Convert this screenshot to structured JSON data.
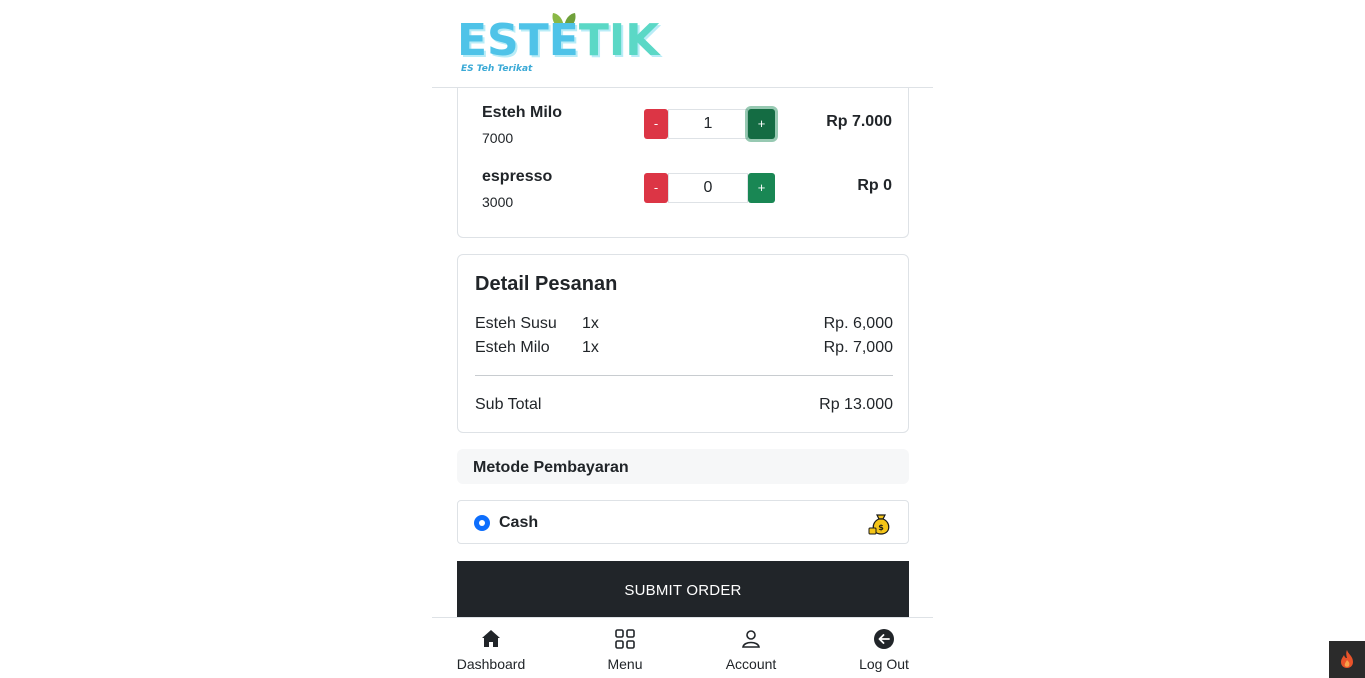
{
  "header": {
    "logo_text_a": "ESTE",
    "logo_text_b": "TIK",
    "logo_tagline": "ES Teh Terikat"
  },
  "products": [
    {
      "name": "Esteh Milo",
      "price": "7000",
      "minus": "-",
      "qty": "1",
      "plus": "+",
      "total": "Rp 7.000"
    },
    {
      "name": "espresso",
      "price": "3000",
      "minus": "-",
      "qty": "0",
      "plus": "+",
      "total": "Rp 0"
    }
  ],
  "detail": {
    "title": "Detail Pesanan",
    "items": [
      {
        "name": "Esteh Susu",
        "qty": "1x",
        "price": "Rp. 6,000"
      },
      {
        "name": "Esteh Milo",
        "qty": "1x",
        "price": "Rp. 7,000"
      }
    ],
    "subtotal_label": "Sub Total",
    "subtotal_value": "Rp 13.000"
  },
  "payment": {
    "header": "Metode Pembayaran",
    "option_label": "Cash",
    "selected": true
  },
  "submit_label": "SUBMIT ORDER",
  "nav": {
    "items": [
      {
        "label": "Dashboard",
        "icon": "house-icon"
      },
      {
        "label": "Menu",
        "icon": "grid-icon"
      },
      {
        "label": "Account",
        "icon": "person-icon"
      },
      {
        "label": "Log Out",
        "icon": "arrow-left-circle-icon"
      }
    ]
  },
  "colors": {
    "danger": "#dc3545",
    "success": "#198754",
    "dark": "#212529",
    "primary": "#0d6efd"
  }
}
